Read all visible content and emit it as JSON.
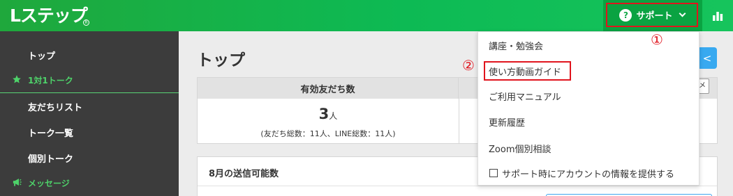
{
  "header": {
    "logo_text": "Lステップ",
    "logo_mark": "R",
    "support_label": "サポート",
    "support_q": "?"
  },
  "sidebar": {
    "items": [
      {
        "label": "トップ",
        "type": "item"
      },
      {
        "label": "1対1トーク",
        "type": "group",
        "icon": "star-icon"
      },
      {
        "label": "友だちリスト",
        "type": "item"
      },
      {
        "label": "トーク一覧",
        "type": "item"
      },
      {
        "label": "個別トーク",
        "type": "item"
      },
      {
        "label": "メッセージ",
        "type": "group",
        "icon": "megaphone-icon"
      }
    ]
  },
  "main": {
    "title": "トップ",
    "friends_card": {
      "header": "有効友だち数",
      "count": "3",
      "unit": "人",
      "detail": "(友だち総数：11人、LINE総数：11人)"
    },
    "side_button": "<",
    "small_button": "メ",
    "send_card": {
      "title": "8月の送信可能数"
    }
  },
  "dropdown": {
    "items": [
      {
        "label": "講座・勉強会"
      },
      {
        "label": "使い方動画ガイド"
      },
      {
        "label": "ご利用マニュアル"
      },
      {
        "label": "更新履歴"
      },
      {
        "label": "Zoom個別相談"
      },
      {
        "label": "サポート時にアカウントの情報を提供する",
        "checkbox": true,
        "checked": false
      }
    ]
  },
  "annotations": {
    "marker1": "①",
    "marker2": "②"
  },
  "colors": {
    "header_green": "#0dba54",
    "sidebar_bg": "#3c3c3c",
    "accent_green": "#4ed36a",
    "annotation_red": "#e0141d",
    "button_blue": "#38a9f0"
  }
}
